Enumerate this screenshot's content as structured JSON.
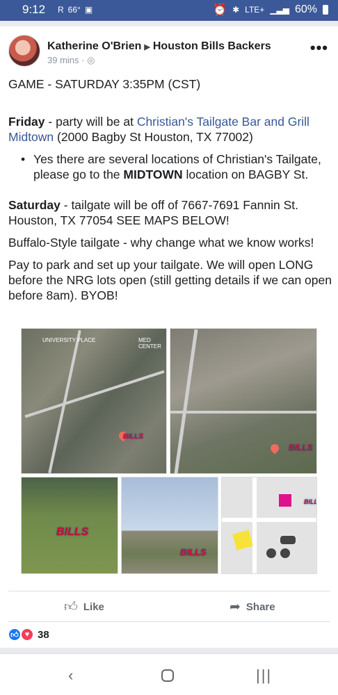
{
  "status": {
    "time": "9:12",
    "temp": "66°",
    "network": "LTE+",
    "battery": "60%",
    "icons": [
      "rakuten-icon",
      "image-icon",
      "alarm-icon",
      "bluetooth-icon",
      "signal-icon",
      "battery-icon"
    ]
  },
  "post": {
    "author": "Katherine O'Brien",
    "group": "Houston Bills Backers",
    "time": "39 mins",
    "privacy_icon": "globe-icon",
    "line1": "GAME - SATURDAY 3:35PM (CST)",
    "friday_label": "Friday",
    "friday_text": " - party will be at ",
    "friday_link": "Christian's Tailgate Bar and Grill Midtown",
    "friday_addr": " (2000 Bagby St Houston, TX 77002)",
    "bullet_a": "Yes there are several locations of Christian's Tailgate, please go to the ",
    "bullet_bold": "MIDTOWN",
    "bullet_b": " location on BAGBY St.",
    "saturday_label": "Saturday",
    "saturday_text": " - tailgate will be off of 7667-7691 Fannin St. Houston, TX 77054 SEE MAPS BELOW!",
    "line_buffalo": "Buffalo-Style tailgate - why change what we know works!",
    "line_pay": "Pay to park and set up your tailgate.  We will open LONG before the NRG lots open (still getting details if we can open before 8am).  BYOB!"
  },
  "photos": {
    "map1_labels": [
      "UNIVERSITY PLACE",
      "MED CENTER"
    ],
    "bison_symbol": "BILLS"
  },
  "actions": {
    "like": "Like",
    "share": "Share"
  },
  "reactions": {
    "count": "38"
  }
}
